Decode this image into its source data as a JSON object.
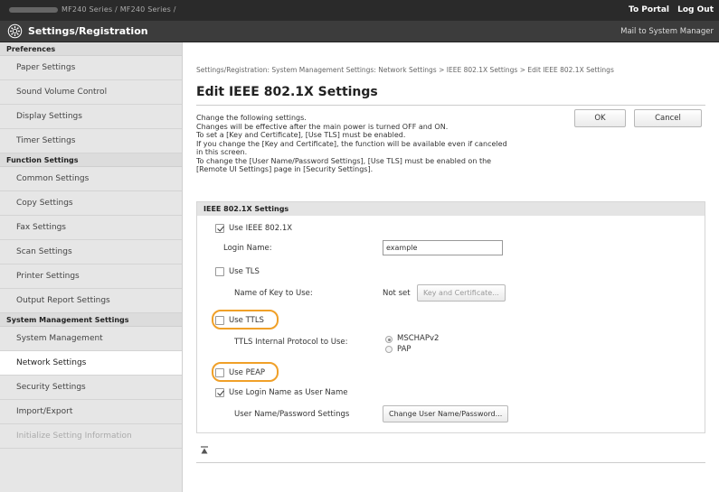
{
  "topbar": {
    "device_name": "MF240 Series / MF240 Series /",
    "to_portal": "To Portal",
    "log_out": "Log Out"
  },
  "header": {
    "title": "Settings/Registration",
    "mail_to": "Mail to System Manager",
    "icon": "gear-icon"
  },
  "sidebar": {
    "preferences_label": "Preferences",
    "preferences": [
      "Paper Settings",
      "Sound Volume Control",
      "Display Settings",
      "Timer Settings"
    ],
    "function_label": "Function Settings",
    "function": [
      "Common Settings",
      "Copy Settings",
      "Fax Settings",
      "Scan Settings",
      "Printer Settings",
      "Output Report Settings"
    ],
    "system_label": "System Management Settings",
    "system": [
      "System Management",
      "Network Settings",
      "Security Settings",
      "Import/Export",
      "Initialize Setting Information"
    ],
    "active_item": "Network Settings"
  },
  "main": {
    "breadcrumb": "Settings/Registration: System Management Settings: Network Settings > IEEE 802.1X Settings > Edit IEEE 802.1X Settings",
    "title": "Edit IEEE 802.1X Settings",
    "description": [
      "Change the following settings.",
      "Changes will be effective after the main power is turned OFF and ON.",
      "To set a [Key and Certificate], [Use TLS] must be enabled.",
      "If you change the [Key and Certificate], the function will be available even if canceled",
      "in this screen.",
      "To change the [User Name/Password Settings], [Use TLS] must be enabled on the",
      "[Remote UI Settings] page in [Security Settings]."
    ],
    "ok_label": "OK",
    "cancel_label": "Cancel"
  },
  "panel": {
    "heading": "IEEE 802.1X Settings",
    "use_ieee_label": "Use IEEE 802.1X",
    "use_ieee_checked": true,
    "login_name_label": "Login Name:",
    "login_name_value": "example",
    "use_tls_label": "Use TLS",
    "use_tls_checked": false,
    "key_name_label": "Name of Key to Use:",
    "key_name_value": "Not set",
    "key_button": "Key and Certificate...",
    "use_ttls_label": "Use TTLS",
    "use_ttls_checked": false,
    "ttls_protocol_label": "TTLS Internal Protocol to Use:",
    "ttls_options": [
      "MSCHAPv2",
      "PAP"
    ],
    "ttls_selected": "MSCHAPv2",
    "use_peap_label": "Use PEAP",
    "use_peap_checked": false,
    "use_login_as_user_label": "Use Login Name as User Name",
    "use_login_as_user_checked": true,
    "user_pw_label": "User Name/Password Settings",
    "user_pw_button": "Change User Name/Password...",
    "highlight_color": "#f0a028"
  },
  "footer": {
    "to_top_icon": "arrow-up-to-top-icon"
  }
}
